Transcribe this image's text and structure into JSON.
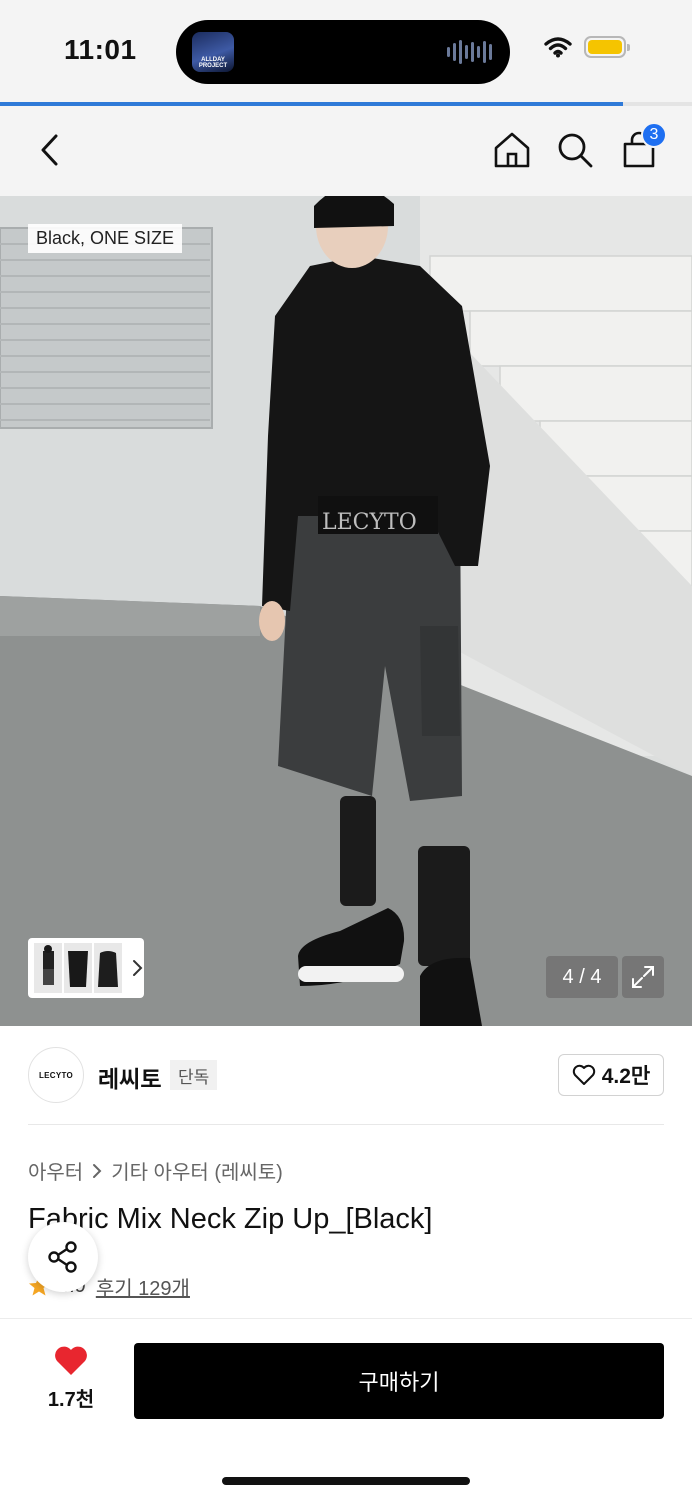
{
  "status_bar": {
    "time": "11:01",
    "island_art_text": "ALLDAY PROJECT",
    "battery_level": 1.0,
    "colors": {
      "battery": "#f5c400"
    }
  },
  "page_load_progress": 0.9,
  "nav": {
    "back_icon": "chevron-left-icon",
    "home_icon": "home-icon",
    "search_icon": "search-icon",
    "cart_icon": "shopping-bag-icon",
    "cart_count": "3"
  },
  "gallery": {
    "option_tag": "Black, ONE SIZE",
    "counter": "4 / 4",
    "expand_icon": "expand-icon",
    "current_image": 4,
    "total_images": 4
  },
  "brand": {
    "logo_text": "LECYTO",
    "name": "레씨토",
    "badge": "단독",
    "like_count": "4.2만"
  },
  "product": {
    "breadcrumb": [
      "아우터",
      "기타 아우터 (레씨토)"
    ],
    "title": "Fabric Mix Neck Zip Up_[Black]",
    "rating": "4.9",
    "review_label": "후기 129개"
  },
  "bottom_bar": {
    "like_count": "1.7천",
    "buy_label": "구매하기"
  },
  "colors": {
    "accent": "#1e6ff1",
    "progress": "#2f7ad8",
    "heart": "#e8262f",
    "star": "#f5a623",
    "buy_button": "#000000"
  }
}
